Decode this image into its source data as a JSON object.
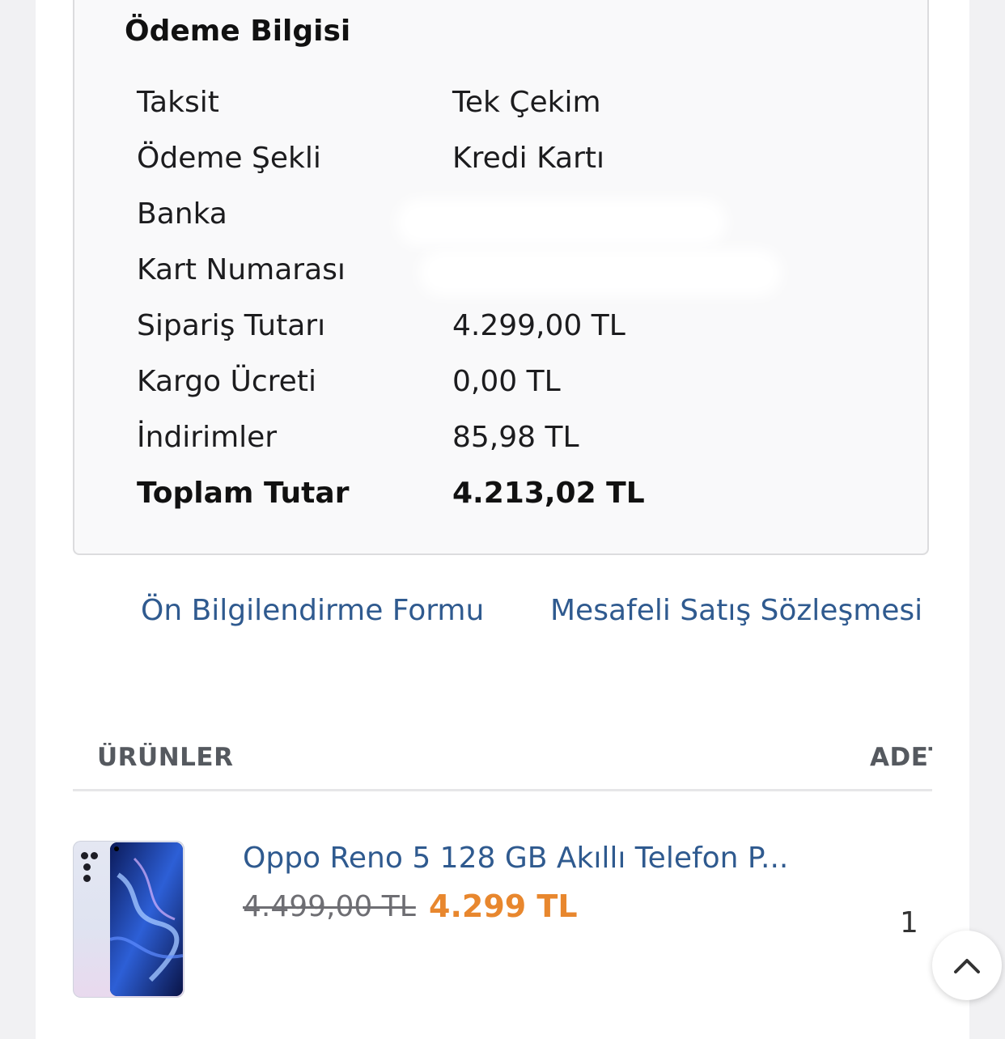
{
  "payment": {
    "title": "Ödeme Bilgisi",
    "rows": [
      {
        "label": "Taksit",
        "value": "Tek Çekim"
      },
      {
        "label": "Ödeme Şekli",
        "value": "Kredi Kartı"
      },
      {
        "label": "Banka",
        "value": ""
      },
      {
        "label": "Kart Numarası",
        "value": ""
      },
      {
        "label": "Sipariş Tutarı",
        "value": "4.299,00 TL"
      },
      {
        "label": "Kargo Ücreti",
        "value": "0,00 TL"
      },
      {
        "label": "İndirimler",
        "value": "85,98 TL"
      },
      {
        "label": "Toplam Tutar",
        "value": "4.213,02 TL"
      }
    ]
  },
  "links": {
    "pre_info": "Ön Bilgilendirme Formu",
    "distance_sales": "Mesafeli Satış Sözleşmesi"
  },
  "products": {
    "header_products": "ÜRÜNLER",
    "header_qty": "ADET",
    "items": [
      {
        "name": "Oppo Reno 5 128 GB Akıllı Telefon P...",
        "old_price": "4.499,00 TL",
        "new_price": "4.299 TL",
        "quantity": "1",
        "image_icon": "phone-product-image"
      }
    ]
  },
  "colors": {
    "link": "#2f5a8f",
    "discount_price": "#e8872e"
  },
  "icons": {
    "scroll_top": "chevron-up-icon"
  }
}
